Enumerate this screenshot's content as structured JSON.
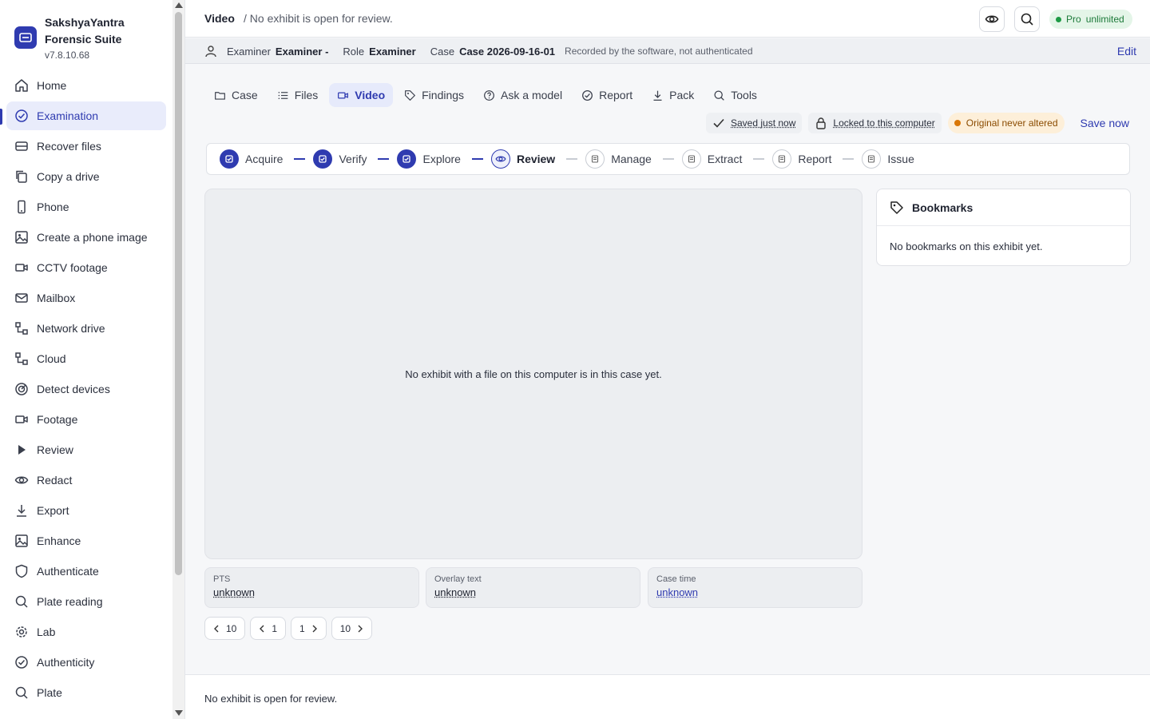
{
  "app": {
    "name_line1": "SakshyaYantra",
    "name_line2": "Forensic Suite",
    "version": "v7.8.10.68"
  },
  "sidebar": {
    "items": [
      {
        "label": "Home",
        "icon": "home-icon"
      },
      {
        "label": "Examination",
        "icon": "check-circle-icon",
        "active": true
      },
      {
        "label": "Recover files",
        "icon": "drive-icon"
      },
      {
        "label": "Copy a drive",
        "icon": "copy-icon"
      },
      {
        "label": "Phone",
        "icon": "phone-icon"
      },
      {
        "label": "Create a phone image",
        "icon": "image-icon"
      },
      {
        "label": "CCTV footage",
        "icon": "camera-icon"
      },
      {
        "label": "Mailbox",
        "icon": "mail-icon"
      },
      {
        "label": "Network drive",
        "icon": "network-icon"
      },
      {
        "label": "Cloud",
        "icon": "network-icon"
      },
      {
        "label": "Detect devices",
        "icon": "radar-icon"
      },
      {
        "label": "Footage",
        "icon": "camera-icon"
      },
      {
        "label": "Review",
        "icon": "play-icon"
      },
      {
        "label": "Redact",
        "icon": "eye-icon"
      },
      {
        "label": "Export",
        "icon": "download-icon"
      },
      {
        "label": "Enhance",
        "icon": "image-icon"
      },
      {
        "label": "Authenticate",
        "icon": "shield-icon"
      },
      {
        "label": "Plate reading",
        "icon": "search-icon"
      },
      {
        "label": "Lab",
        "icon": "gear-icon"
      },
      {
        "label": "Authenticity",
        "icon": "check-circle-icon"
      },
      {
        "label": "Plate",
        "icon": "search-icon"
      }
    ]
  },
  "header": {
    "title": "Video",
    "crumb": "/ No exhibit is open for review.",
    "pro_label": "Pro",
    "pro_value": "unlimited"
  },
  "meta": {
    "examiner_label": "Examiner",
    "examiner_value": "Examiner -",
    "role_label": "Role",
    "role_value": "Examiner",
    "case_label": "Case",
    "case_value": "Case 2026-09-16-01",
    "note": "Recorded by the software, not authenticated",
    "edit": "Edit"
  },
  "tabs": [
    {
      "label": "Case",
      "icon": "folder-icon"
    },
    {
      "label": "Files",
      "icon": "list-icon"
    },
    {
      "label": "Video",
      "icon": "video-icon",
      "active": true
    },
    {
      "label": "Findings",
      "icon": "tag-icon"
    },
    {
      "label": "Ask a model",
      "icon": "help-icon"
    },
    {
      "label": "Report",
      "icon": "check-circle-icon"
    },
    {
      "label": "Pack",
      "icon": "download-icon"
    },
    {
      "label": "Tools",
      "icon": "search-icon"
    }
  ],
  "status": {
    "saved": "Saved just now",
    "locked": "Locked to this computer",
    "original": "Original never altered",
    "save_now": "Save now"
  },
  "steps": [
    {
      "label": "Acquire",
      "state": "done"
    },
    {
      "label": "Verify",
      "state": "done"
    },
    {
      "label": "Explore",
      "state": "done"
    },
    {
      "label": "Review",
      "state": "current"
    },
    {
      "label": "Manage",
      "state": "todo"
    },
    {
      "label": "Extract",
      "state": "todo"
    },
    {
      "label": "Report",
      "state": "todo"
    },
    {
      "label": "Issue",
      "state": "todo"
    }
  ],
  "viewer": {
    "empty_message": "No exhibit with a file on this computer is in this case yet."
  },
  "bookmarks": {
    "title": "Bookmarks",
    "empty": "No bookmarks on this exhibit yet."
  },
  "fields": [
    {
      "label": "PTS",
      "value": "unknown"
    },
    {
      "label": "Overlay text",
      "value": "unknown"
    },
    {
      "label": "Case time",
      "value": "unknown"
    }
  ],
  "pager": {
    "b1": "10",
    "b2": "1",
    "b3": "1",
    "b4": "10"
  },
  "footer": {
    "message": "No exhibit is open for review."
  },
  "colors": {
    "accent": "#2f3bb0",
    "pro_green": "#1d9a45",
    "original_orange": "#d97706"
  }
}
